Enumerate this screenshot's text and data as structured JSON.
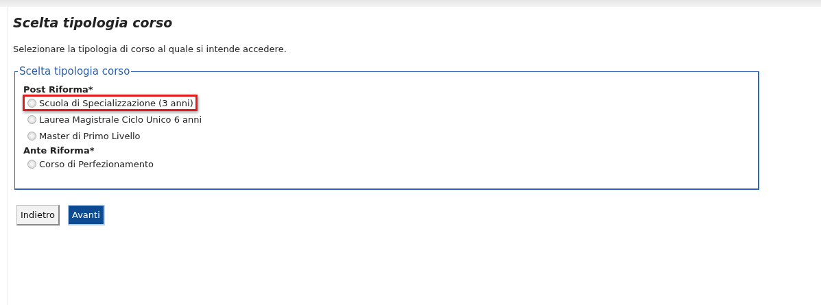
{
  "title": "Scelta tipologia corso",
  "intro": "Selezionare la tipologia di corso al quale si intende accedere.",
  "fieldset": {
    "legend": "Scelta tipologia corso",
    "groups": [
      {
        "label": "Post Riforma*",
        "options": [
          {
            "label": "Scuola di Specializzazione (3 anni)",
            "selected": false,
            "highlighted": true
          },
          {
            "label": "Laurea Magistrale Ciclo Unico 6 anni",
            "selected": false,
            "highlighted": false
          },
          {
            "label": "Master di Primo Livello",
            "selected": false,
            "highlighted": false
          }
        ]
      },
      {
        "label": "Ante Riforma*",
        "options": [
          {
            "label": "Corso di Perfezionamento",
            "selected": false,
            "highlighted": false
          }
        ]
      }
    ]
  },
  "buttons": [
    {
      "label": "Indietro",
      "kind": "secondary"
    },
    {
      "label": "Avanti",
      "kind": "primary"
    }
  ]
}
